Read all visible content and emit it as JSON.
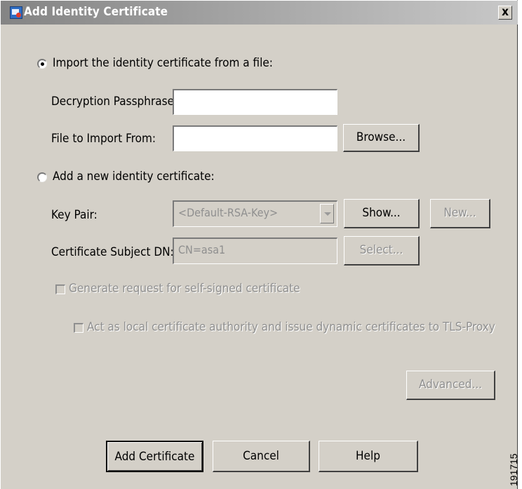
{
  "dialog": {
    "title": "Add Identity Certificate",
    "close_glyph": "x"
  },
  "import_section": {
    "radio_label": "Import the identity certificate from a file:",
    "selected": true,
    "passphrase_label": "Decryption Passphrase:",
    "passphrase_value": "",
    "file_label": "File to Import From:",
    "file_value": "",
    "browse_label": "Browse..."
  },
  "new_section": {
    "radio_label": "Add a new identity certificate:",
    "selected": false,
    "keypair_label": "Key Pair:",
    "keypair_value": "<Default-RSA-Key>",
    "show_label": "Show...",
    "new_label": "New...",
    "subject_label": "Certificate Subject DN:",
    "subject_value": "CN=asa1",
    "select_label": "Select...",
    "self_signed_label": "Generate request for self-signed certificate",
    "self_signed_checked": false,
    "local_ca_label": "Act as local certificate authority and issue dynamic certificates to TLS-Proxy",
    "local_ca_checked": false,
    "advanced_label": "Advanced..."
  },
  "footer": {
    "add_label": "Add Certificate",
    "cancel_label": "Cancel",
    "help_label": "Help"
  },
  "figure_id": "191715",
  "icons": {
    "title": "certificate-icon",
    "dropdown": "chevron-down-icon"
  }
}
